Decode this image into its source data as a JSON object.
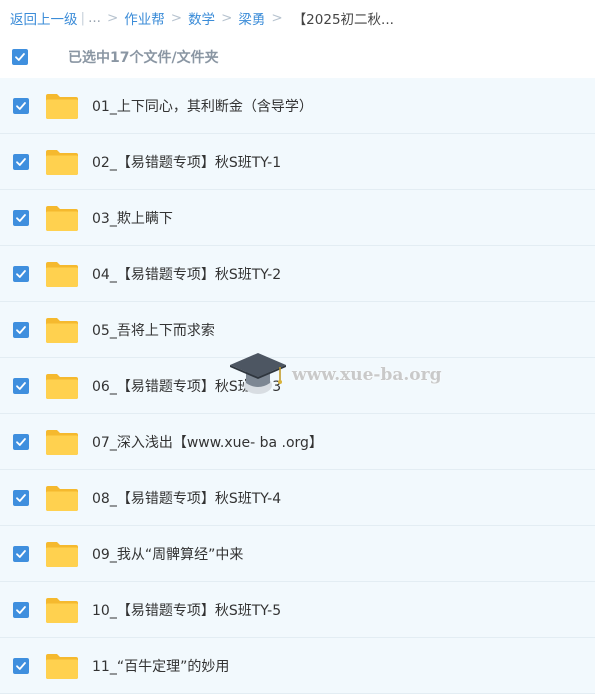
{
  "breadcrumb": {
    "back": "返回上一级",
    "ellipsis": "...",
    "items": [
      "作业帮",
      "数学",
      "梁勇"
    ],
    "current": "【2025初二秋..."
  },
  "selection": {
    "text": "已选中17个文件/文件夹",
    "checked": true
  },
  "icons": {
    "checkbox": "checkbox-checked-icon",
    "folder": "folder-icon",
    "watermark": "graduation-cap-icon"
  },
  "colors": {
    "accent": "#3f8fde",
    "link": "#3b8cd8",
    "row_bg": "#f2f9fd",
    "folder": "#ffd14f"
  },
  "files": [
    {
      "name": "01_上下同心，其利断金（含导学）",
      "checked": true
    },
    {
      "name": "02_【易错题专项】秋S班TY-1",
      "checked": true
    },
    {
      "name": "03_欺上瞒下",
      "checked": true
    },
    {
      "name": "04_【易错题专项】秋S班TY-2",
      "checked": true
    },
    {
      "name": "05_吾将上下而求索",
      "checked": true
    },
    {
      "name": "06_【易错题专项】秋S班TY-3",
      "checked": true
    },
    {
      "name": "07_深入浅出【www.xue- ba .org】",
      "checked": true
    },
    {
      "name": "08_【易错题专项】秋S班TY-4",
      "checked": true
    },
    {
      "name": "09_我从“周髀算经”中来",
      "checked": true
    },
    {
      "name": "10_【易错题专项】秋S班TY-5",
      "checked": true
    },
    {
      "name": "11_“百牛定理”的妙用",
      "checked": true
    }
  ],
  "watermark": {
    "text": "www.xue-ba.org"
  }
}
